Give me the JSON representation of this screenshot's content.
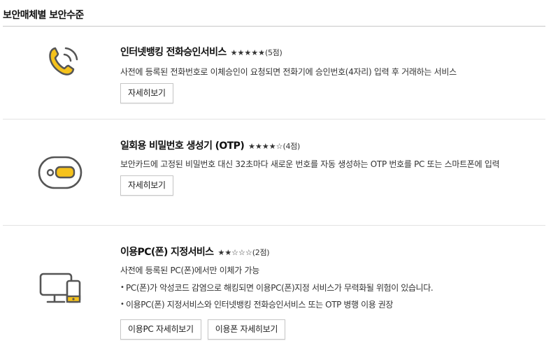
{
  "section_title": "보안매체별 보안수준",
  "colors": {
    "icon_yellow": "#f5c21c",
    "icon_gray": "#555555"
  },
  "items": [
    {
      "icon": "phone-icon",
      "title": "인터넷뱅킹 전화승인서비스",
      "stars": "★★★★★",
      "rating": 5,
      "score": "(5점)",
      "desc": "사전에 등록된 전화번호로 이체승인이 요청되면 전화기에 승인번호(4자리) 입력 후 거래하는 서비스",
      "buttons": [
        "자세히보기"
      ]
    },
    {
      "icon": "otp-token-icon",
      "title": "일회용 비밀번호 생성기 (OTP)",
      "stars": "★★★★☆",
      "rating": 4,
      "score": "(4점)",
      "desc": "보안카드에 고정된 비밀번호 대신 32초마다 새로운 번호를 자동 생성하는 OTP 번호를 PC 또는 스마트폰에 입력",
      "buttons": [
        "자세히보기"
      ]
    },
    {
      "icon": "pc-phone-icon",
      "title": "이용PC(폰) 지정서비스",
      "stars": "★★☆☆☆",
      "rating": 2,
      "score": "(2점)",
      "desc": "사전에 등록된 PC(폰)에서만 이체가 가능",
      "bullets": [
        "PC(폰)가 악성코드 감염으로 해킹되면 이용PC(폰)지정 서비스가 무력화될 위험이 있습니다.",
        "이용PC(폰) 지정서비스와 인터넷뱅킹 전화승인서비스 또는 OTP 병행 이용 권장"
      ],
      "buttons": [
        "이용PC 자세히보기",
        "이용폰 자세히보기"
      ]
    }
  ]
}
